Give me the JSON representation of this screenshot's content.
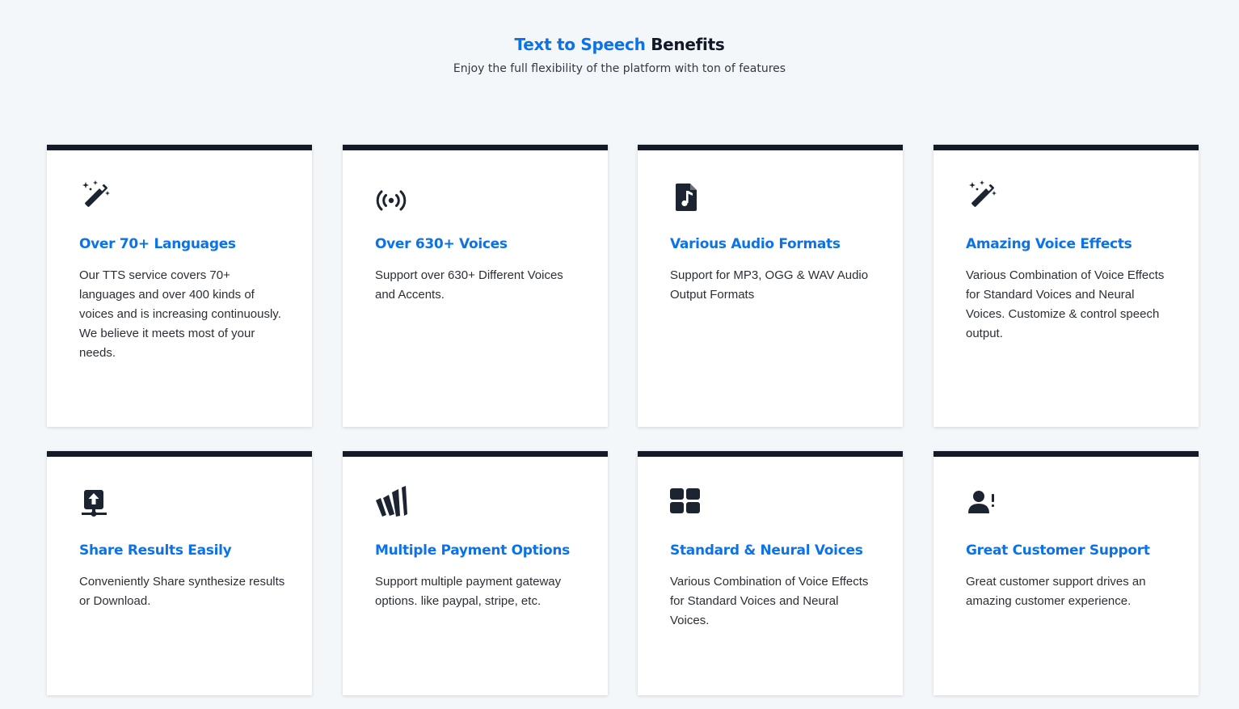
{
  "header": {
    "title_accent": "Text to Speech",
    "title_rest": "Benefits",
    "subtitle": "Enjoy the full flexibility of the platform with ton of features"
  },
  "colors": {
    "accent": "#0b72e7",
    "card_top_border": "#141a28",
    "background": "#f4f7fa",
    "icon": "#1c2331"
  },
  "cards": [
    {
      "icon": "magic-wand-icon",
      "title": "Over 70+ Languages",
      "text": "Our TTS service covers 70+ languages and over 400 kinds of voices and is increasing continuously. We believe it meets most of your needs."
    },
    {
      "icon": "broadcast-icon",
      "title": "Over 630+ Voices",
      "text": "Support over 630+ Different Voices and Accents."
    },
    {
      "icon": "audio-file-icon",
      "title": "Various Audio Formats",
      "text": "Support for MP3, OGG & WAV Audio Output Formats"
    },
    {
      "icon": "magic-wand-icon",
      "title": "Amazing Voice Effects",
      "text": "Various Combination of Voice Effects for Standard Voices and Neural Voices. Customize & control speech output."
    },
    {
      "icon": "upload-share-icon",
      "title": "Share Results Easily",
      "text": "Conveniently Share synthesize results or Download."
    },
    {
      "icon": "payment-gateway-icon",
      "title": "Multiple Payment Options",
      "text": "Support multiple payment gateway options. like paypal, stripe, etc."
    },
    {
      "icon": "grid-icon",
      "title": "Standard & Neural Voices",
      "text": "Various Combination of Voice Effects for Standard Voices and Neural Voices."
    },
    {
      "icon": "user-alert-icon",
      "title": "Great Customer Support",
      "text": "Great customer support drives an amazing customer experience."
    }
  ]
}
